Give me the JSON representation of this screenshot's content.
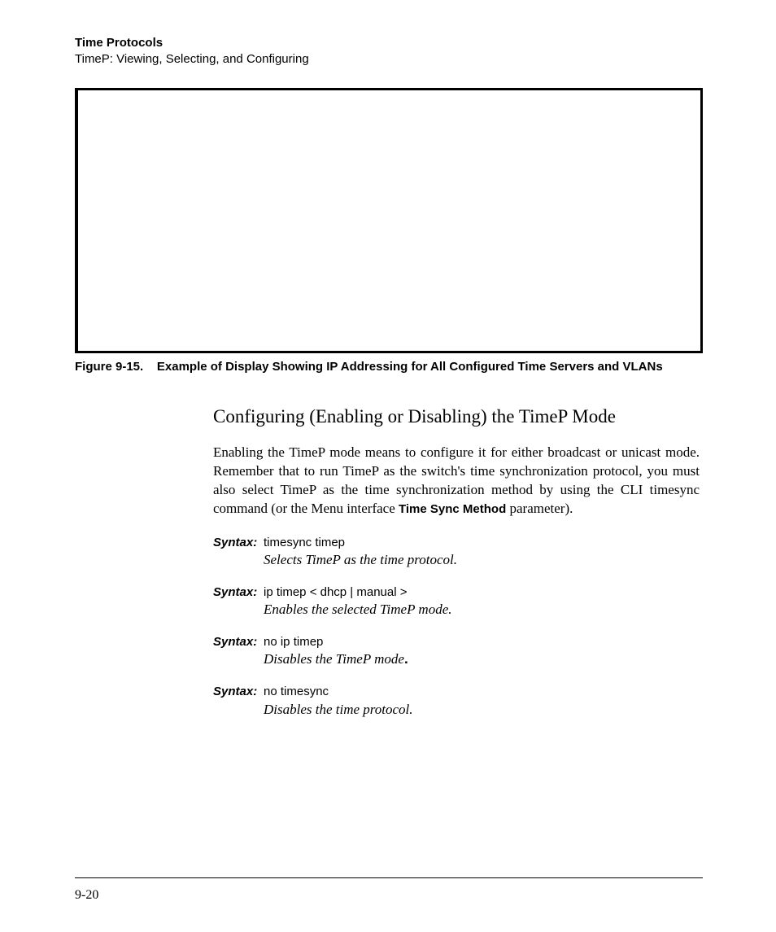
{
  "header": {
    "chapter": "Time Protocols",
    "section": "TimeP: Viewing, Selecting, and Configuring"
  },
  "figure": {
    "caption_prefix": "Figure 9-15.",
    "caption_text": "Example of Display Showing IP Addressing for All Configured Time Servers and VLANs"
  },
  "heading": "Configuring (Enabling or Disabling) the TimeP Mode",
  "paragraph": {
    "part1": "Enabling the TimeP mode means to configure it for either broadcast or unicast mode. Remember that to run TimeP as the switch's time synchronization protocol, you must also select TimeP as the time synchronization method by using the CLI timesync command (or the Menu interface ",
    "bold": "Time Sync Method",
    "part2": " parameter)."
  },
  "syntax_label": "Syntax:",
  "syntax": [
    {
      "cmd": "timesync timep",
      "desc": "Selects TimeP as the time protocol.",
      "bold_period": false
    },
    {
      "cmd": "ip timep < dhcp | manual >",
      "desc": "Enables the selected TimeP mode.",
      "bold_period": false
    },
    {
      "cmd": "no ip timep",
      "desc": "Disables the TimeP mode",
      "bold_period": true
    },
    {
      "cmd": "no timesync",
      "desc": "Disables the time protocol.",
      "bold_period": false
    }
  ],
  "page_number": "9-20"
}
